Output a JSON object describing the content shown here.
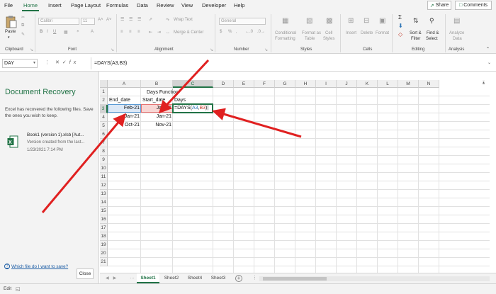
{
  "tabs": {
    "file": "File",
    "home": "Home",
    "insert": "Insert",
    "page_layout": "Page Layout",
    "formulas": "Formulas",
    "data": "Data",
    "review": "Review",
    "view": "View",
    "developer": "Developer",
    "help": "Help"
  },
  "share_label": "Share",
  "comments_label": "Comments",
  "ribbon": {
    "clipboard": {
      "label": "Clipboard",
      "paste": "Paste"
    },
    "font": {
      "label": "Font",
      "font_name": "Calibri",
      "font_size": "11"
    },
    "alignment": {
      "label": "Alignment",
      "wrap_text": "Wrap Text",
      "merge_center": "Merge & Center"
    },
    "number": {
      "label": "Number",
      "format": "General"
    },
    "styles": {
      "label": "Styles",
      "conditional": "Conditional",
      "conditional2": "Formatting",
      "format_as": "Format as",
      "format_as2": "Table",
      "cell": "Cell",
      "cell2": "Styles"
    },
    "cells": {
      "label": "Cells",
      "insert": "Insert",
      "delete": "Delete",
      "format": "Format"
    },
    "editing": {
      "label": "Editing",
      "sort": "Sort &",
      "sort2": "Filter",
      "find": "Find &",
      "find2": "Select"
    },
    "analysis": {
      "label": "Analysis",
      "analyze": "Analyze",
      "analyze2": "Data"
    }
  },
  "formula_bar": {
    "name_box": "DAY",
    "formula": "=DAYS(A3,B3)"
  },
  "recovery": {
    "title": "Document Recovery",
    "description": "Excel has recovered the following files.  Save the ones you wish to keep.",
    "file_name": "Book1 (version 1).xlsb  [Aut...",
    "file_version": "Version created from the last...",
    "file_date": "1/23/2021 7:14 PM",
    "help_link": "Which file do I want to save?",
    "close_label": "Close"
  },
  "grid": {
    "columns": [
      "A",
      "B",
      "C",
      "D",
      "E",
      "F",
      "G",
      "H",
      "I",
      "J",
      "K",
      "L",
      "M",
      "N"
    ],
    "rows": [
      "1",
      "2",
      "3",
      "4",
      "5",
      "6",
      "7",
      "8",
      "9",
      "10",
      "11",
      "12",
      "13",
      "14",
      "15",
      "16",
      "17",
      "18",
      "19",
      "20",
      "21"
    ],
    "b1": "Days Function",
    "a2": "End_date",
    "b2": "Start_date",
    "c2": "Days",
    "a3": "Feb-21",
    "b3": "Jan-21",
    "c3_prefix": "=DAYS(",
    "c3_ref_a": "A3",
    "c3_comma": ",",
    "c3_ref_b": "B3",
    "c3_suffix": ")",
    "a4": "Jan-21",
    "b4": "Jan-21",
    "a5": "Oct-21",
    "b5": "Nov-21"
  },
  "sheets": [
    "Sheet1",
    "Sheet2",
    "Sheet4",
    "Sheet3"
  ],
  "status": {
    "mode": "Edit"
  },
  "colors": {
    "accent": "#217346",
    "arrow": "#e02020"
  }
}
